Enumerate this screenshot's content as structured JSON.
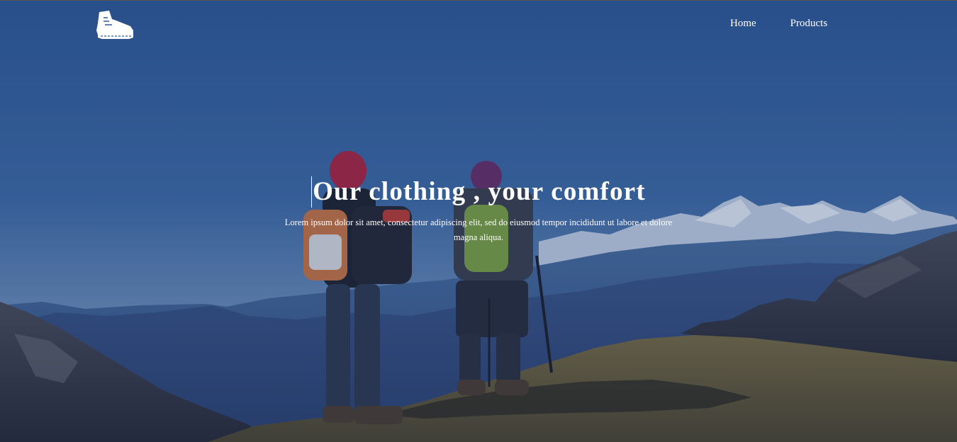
{
  "nav": {
    "logo_icon": "hiking-boot-icon",
    "links": [
      {
        "label": "Home"
      },
      {
        "label": "Products"
      }
    ]
  },
  "hero": {
    "headline": "Our clothing , your comfort",
    "subtext": "Lorem ipsum dolor sit amet, consectetur adipiscing elit, sed do eiusmod tempor incididunt ut labore et dolore magna aliqua.",
    "background_description_icon": "mountain-hikers-photo"
  },
  "colors": {
    "sky": "#2f5b95",
    "text": "#ffffff",
    "ground": "#6b5a2e"
  }
}
